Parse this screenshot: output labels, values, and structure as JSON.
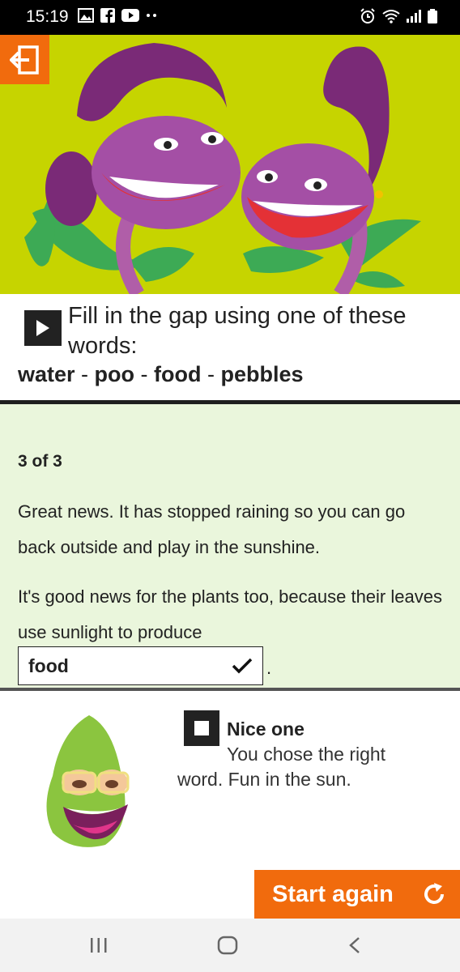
{
  "status_bar": {
    "time": "15:19",
    "left_icons": [
      "image-icon",
      "facebook-icon",
      "youtube-icon",
      "more-dots-icon"
    ],
    "right_icons": [
      "alarm-icon",
      "wifi-icon",
      "signal-icon",
      "battery-icon"
    ]
  },
  "header": {
    "back_icon": "exit-arrow-icon",
    "accent_color": "#f16b0d",
    "hero_bg": "#c6d400"
  },
  "instruction": {
    "text": "Fill in the gap using one of these words:",
    "words": [
      "water",
      "poo",
      "food",
      "pebbles"
    ],
    "separator": " - "
  },
  "question": {
    "progress": "3 of 3",
    "para1": "Great news. It has stopped raining so you can go back outside and play in the sunshine.",
    "para2": "It's good news for the plants too, because their leaves use sunlight to produce",
    "answer": "food",
    "after_gap": "."
  },
  "feedback": {
    "title": "Nice one",
    "body": "You chose the right word. Fun in the sun."
  },
  "actions": {
    "start_again": "Start again"
  },
  "colors": {
    "question_bg": "#eaf6dc",
    "dark": "#222222"
  }
}
